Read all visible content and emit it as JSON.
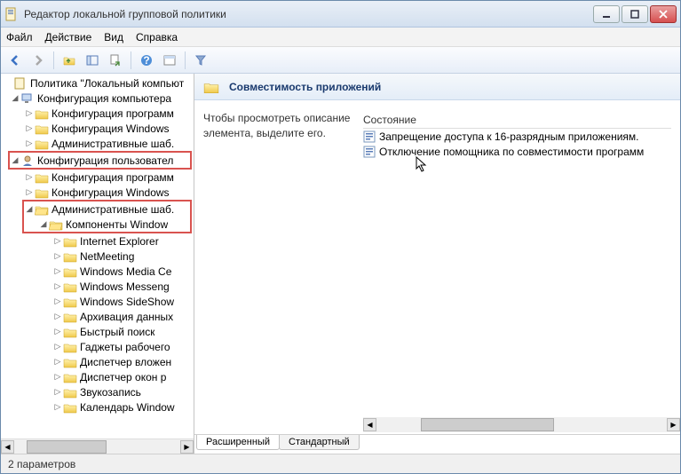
{
  "window": {
    "title": "Редактор локальной групповой политики"
  },
  "menu": {
    "file": "Файл",
    "action": "Действие",
    "view": "Вид",
    "help": "Справка"
  },
  "tree": {
    "root": "Политика \"Локальный компьют",
    "computer_cfg": "Конфигурация компьютера",
    "cc_software": "Конфигурация программ",
    "cc_windows": "Конфигурация Windows",
    "cc_admin": "Административные шаб.",
    "user_cfg": "Конфигурация пользовател",
    "uc_software": "Конфигурация программ",
    "uc_windows": "Конфигурация Windows",
    "uc_admin": "Административные шаб.",
    "win_components": "Компоненты Window",
    "items": [
      "Internet Explorer",
      "NetMeeting",
      "Windows Media Ce",
      "Windows Messeng",
      "Windows SideShow",
      "Архивация данных",
      "Быстрый поиск",
      "Гаджеты рабочего",
      "Диспетчер вложен",
      "Диспетчер окон р",
      "Звукозапись",
      "Календарь Window"
    ]
  },
  "detail": {
    "header": "Совместимость приложений",
    "hint": "Чтобы просмотреть описание элемента, выделите его.",
    "column": "Состояние",
    "rows": [
      "Запрещение доступа к 16-разрядным приложениям.",
      "Отключение помощника по совместимости программ"
    ]
  },
  "tabs": {
    "extended": "Расширенный",
    "standard": "Стандартный"
  },
  "status": "2 параметров"
}
